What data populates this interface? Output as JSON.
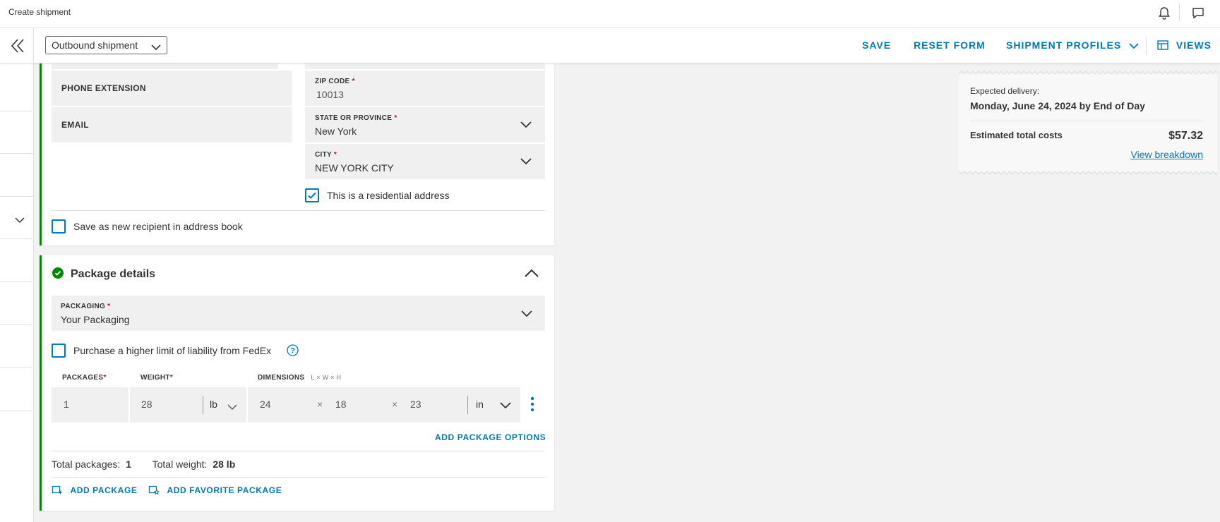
{
  "app": {
    "title": "Create shipment"
  },
  "icons": {
    "bell": "bell-icon",
    "chat": "chat-icon",
    "collapse": "double-chevron-left-icon",
    "chevron": "chevron-down-icon",
    "views": "views-grid-icon",
    "check_circle": "check-circle-icon",
    "help": "help-icon",
    "more": "more-vertical-icon",
    "add_package": "add-package-icon",
    "favorite_package": "favorite-package-icon"
  },
  "colors": {
    "accent": "#007ab7",
    "success": "#008a00",
    "required": "#de002e"
  },
  "header": {
    "shipment_type": "Outbound shipment",
    "save": "SAVE",
    "reset": "RESET FORM",
    "profiles": "SHIPMENT PROFILES",
    "views": "VIEWS"
  },
  "recipient": {
    "phone_extension_label": "PHONE EXTENSION",
    "email_label": "EMAIL",
    "zip": {
      "label": "ZIP CODE",
      "value": "10013"
    },
    "state": {
      "label": "STATE OR PROVINCE",
      "value": "New York"
    },
    "city": {
      "label": "CITY",
      "value": "NEW YORK CITY"
    },
    "residential_label": "This is a residential address",
    "residential_checked": true,
    "save_recipient_label": "Save as new recipient in address book",
    "save_recipient_checked": false,
    "required_mark": "*"
  },
  "package": {
    "title": "Package details",
    "packaging": {
      "label": "PACKAGING",
      "value": "Your Packaging"
    },
    "liability_label": "Purchase a higher limit of liability from FedEx",
    "liability_checked": false,
    "packages_label": "PACKAGES",
    "weight_label": "WEIGHT",
    "dimensions_label": "DIMENSIONS",
    "dimensions_hint": "L × W × H",
    "packages_value": "1",
    "weight_value": "28",
    "weight_unit": "lb",
    "length": "24",
    "width": "18",
    "height": "23",
    "times": "×",
    "dim_unit": "in",
    "add_options": "ADD PACKAGE OPTIONS",
    "total_packages_label": "Total packages:",
    "total_packages_value": "1",
    "total_weight_label": "Total weight:",
    "total_weight_value": "28 lb",
    "add_package": "ADD PACKAGE",
    "add_favorite": "ADD FAVORITE PACKAGE"
  },
  "summary": {
    "expected_label": "Expected delivery:",
    "expected_value": "Monday, June 24, 2024 by End of Day",
    "cost_label": "Estimated total costs",
    "cost_value": "$57.32",
    "breakdown": "View breakdown"
  }
}
